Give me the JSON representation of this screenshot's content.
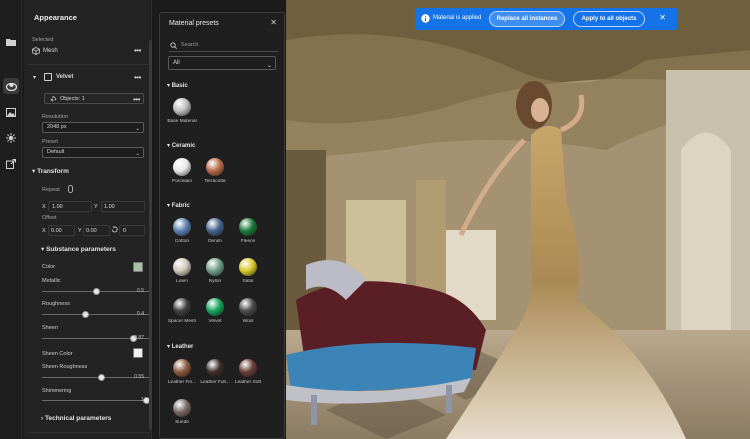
{
  "toast": {
    "message": "Material is applied",
    "replace_label": "Replace all instances",
    "apply_label": "Apply to all objects"
  },
  "appearance": {
    "title": "Appearance",
    "selected_label": "Selected",
    "selected_value": "Mesh",
    "material_name": "Velvet",
    "objects_label": "Objects: 1",
    "resolution_label": "Resolution",
    "resolution_value": "2048 px",
    "preset_label": "Preset",
    "preset_value": "Default",
    "transform_title": "Transform",
    "repeat_label": "Repeat",
    "repeat_x_label": "X",
    "repeat_x": "1.00",
    "repeat_y_label": "Y",
    "repeat_y": "1.00",
    "offset_label": "Offset",
    "offset_x_label": "X",
    "offset_x": "0.00",
    "offset_y_label": "Y",
    "offset_y": "0.00",
    "rotation": "0",
    "substance_title": "Substance parameters",
    "color_label": "Color",
    "color_value": "#a9bfa6",
    "metallic_label": "Metallic",
    "metallic_value": "0.5",
    "metallic_fraction": 0.5,
    "roughness_label": "Roughness",
    "roughness_value": "0.4",
    "roughness_fraction": 0.4,
    "sheen_label": "Sheen",
    "sheen_value": "0.87",
    "sheen_fraction": 0.87,
    "sheen_color_label": "Sheen Color",
    "sheen_color_value": "#f0f0f0",
    "sheen_roughness_label": "Sheen Roughness",
    "sheen_roughness_value": "0.55",
    "sheen_roughness_fraction": 0.55,
    "shimmering_label": "Shimmering",
    "shimmering_value": "1",
    "shimmering_fraction": 1,
    "technical_title": "Technical parameters"
  },
  "presets": {
    "title": "Material presets",
    "search_placeholder": "Search",
    "filter_value": "All",
    "categories": [
      {
        "name": "Basic",
        "items": [
          {
            "label": "Base Material",
            "color": "#bdbdbd"
          }
        ]
      },
      {
        "name": "Ceramic",
        "items": [
          {
            "label": "Porcelain",
            "color": "#e6e6e6"
          },
          {
            "label": "Terracotta",
            "color": "#b86a48"
          }
        ]
      },
      {
        "name": "Fabric",
        "items": [
          {
            "label": "Cotton",
            "color": "#5d7fb0"
          },
          {
            "label": "Denim",
            "color": "#45648e"
          },
          {
            "label": "Fleece",
            "color": "#1d7a3a"
          },
          {
            "label": "Linen",
            "color": "#cdc6b8"
          },
          {
            "label": "Nylon",
            "color": "#6f9f8a"
          },
          {
            "label": "Satin",
            "color": "#d7c92b"
          },
          {
            "label": "Spacer Mesh",
            "color": "#3f3f3f"
          },
          {
            "label": "Velvet",
            "color": "#16a45a"
          },
          {
            "label": "Wool",
            "color": "#4a4a4a"
          }
        ]
      },
      {
        "name": "Leather",
        "items": [
          {
            "label": "Leather Fin...",
            "color": "#8a5a3c"
          },
          {
            "label": "Leather Full...",
            "color": "#3d2f2a"
          },
          {
            "label": "Leather Soft",
            "color": "#6a3f38"
          },
          {
            "label": "Suede",
            "color": "#7a6a66"
          }
        ]
      }
    ]
  }
}
